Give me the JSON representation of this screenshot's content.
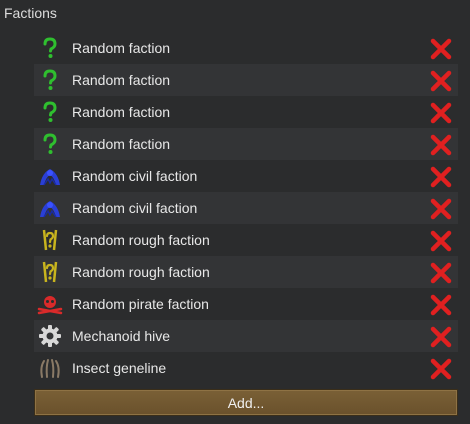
{
  "header": {
    "title": "Factions"
  },
  "factions": [
    {
      "label": "Random faction",
      "icon": "question-icon",
      "color": "#2fbf2f"
    },
    {
      "label": "Random faction",
      "icon": "question-icon",
      "color": "#2fbf2f"
    },
    {
      "label": "Random faction",
      "icon": "question-icon",
      "color": "#2fbf2f"
    },
    {
      "label": "Random faction",
      "icon": "question-icon",
      "color": "#2fbf2f"
    },
    {
      "label": "Random civil faction",
      "icon": "civil-faction-icon",
      "color": "#2a3fd6"
    },
    {
      "label": "Random civil faction",
      "icon": "civil-faction-icon",
      "color": "#2a3fd6"
    },
    {
      "label": "Random rough faction",
      "icon": "rough-faction-icon",
      "color": "#c8b41e"
    },
    {
      "label": "Random rough faction",
      "icon": "rough-faction-icon",
      "color": "#c8b41e"
    },
    {
      "label": "Random pirate faction",
      "icon": "pirate-faction-icon",
      "color": "#d92a2a"
    },
    {
      "label": "Mechanoid hive",
      "icon": "gear-icon",
      "color": "#d8d8d8"
    },
    {
      "label": "Insect geneline",
      "icon": "insect-icon",
      "color": "#8a7a66"
    }
  ],
  "remove_icon": {
    "name": "remove-icon",
    "color": "#e02020"
  },
  "add_button": {
    "label": "Add..."
  }
}
